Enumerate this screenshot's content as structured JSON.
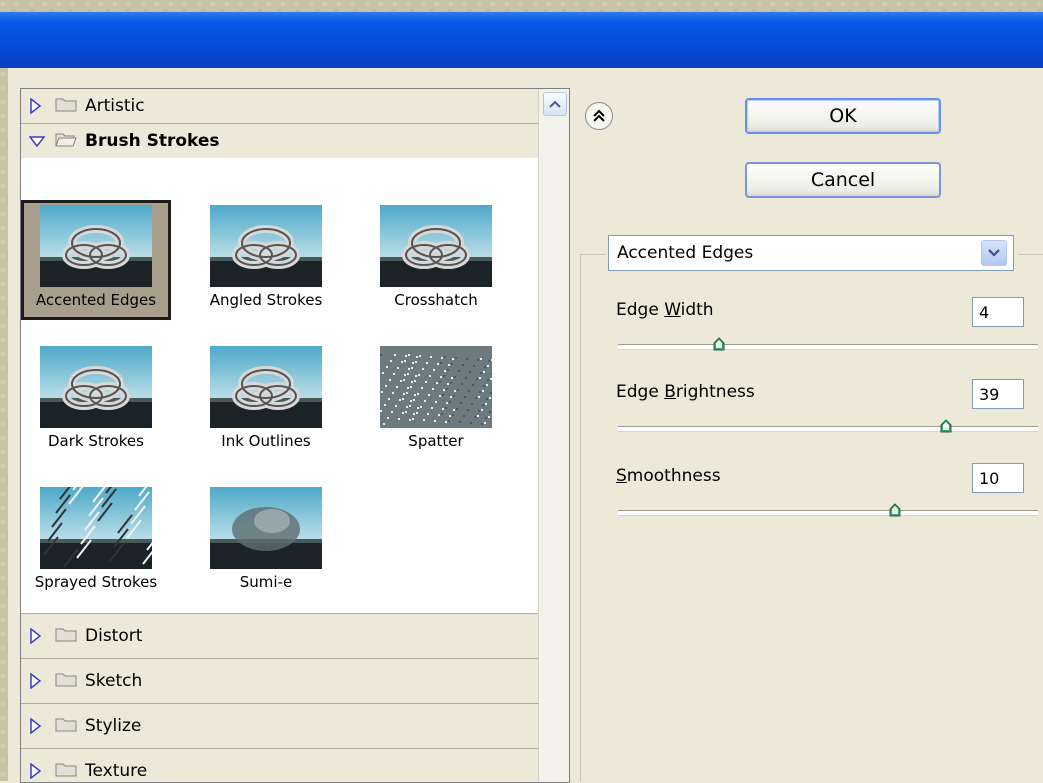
{
  "categories_top": [
    {
      "label": "Artistic",
      "expanded": false
    },
    {
      "label": "Brush Strokes",
      "expanded": true
    }
  ],
  "thumbnails": [
    {
      "caption": "Accented Edges",
      "selected": true
    },
    {
      "caption": "Angled Strokes",
      "selected": false
    },
    {
      "caption": "Crosshatch",
      "selected": false
    },
    {
      "caption": "Dark Strokes",
      "selected": false
    },
    {
      "caption": "Ink Outlines",
      "selected": false
    },
    {
      "caption": "Spatter",
      "selected": false
    },
    {
      "caption": "Sprayed Strokes",
      "selected": false
    },
    {
      "caption": "Sumi-e",
      "selected": false
    }
  ],
  "categories_bottom": [
    {
      "label": "Distort"
    },
    {
      "label": "Sketch"
    },
    {
      "label": "Stylize"
    },
    {
      "label": "Texture"
    }
  ],
  "buttons": {
    "ok": "OK",
    "cancel": "Cancel"
  },
  "filter_select": {
    "value": "Accented Edges"
  },
  "params": [
    {
      "label_pre": "Edge ",
      "label_key": "W",
      "label_post": "idth",
      "value": "4",
      "slider_fraction": 0.24
    },
    {
      "label_pre": "Edge ",
      "label_key": "B",
      "label_post": "rightness",
      "value": "39",
      "slider_fraction": 0.78
    },
    {
      "label_pre": "",
      "label_key": "S",
      "label_post": "moothness",
      "value": "10",
      "slider_fraction": 0.66
    }
  ],
  "colors": {
    "titlebar": "#0548d2",
    "panel_bg": "#ece9d8",
    "knob": "#3fa46a"
  },
  "icons": {
    "expand": "triangle-right-icon",
    "collapse": "triangle-down-icon",
    "folder": "folder-icon",
    "dropdown": "chevron-down-icon",
    "collapse_panel": "double-chevron-up-icon",
    "scroll_up": "scroll-up-icon"
  }
}
